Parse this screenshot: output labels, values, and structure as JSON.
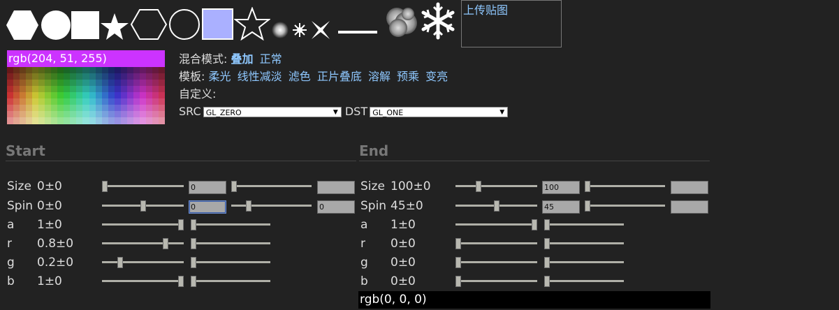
{
  "shapes": [
    {
      "name": "hexagon-filled-icon"
    },
    {
      "name": "circle-filled-icon"
    },
    {
      "name": "square-filled-icon"
    },
    {
      "name": "star-filled-icon"
    },
    {
      "name": "hexagon-outline-icon"
    },
    {
      "name": "circle-outline-icon"
    },
    {
      "name": "square-blue-icon"
    },
    {
      "name": "star-outline-icon"
    },
    {
      "name": "glow-dot-icon"
    },
    {
      "name": "sparkle-icon"
    },
    {
      "name": "cross-sparkle-icon"
    },
    {
      "name": "line-icon"
    },
    {
      "name": "smoke-icon"
    },
    {
      "name": "snowflake-icon"
    }
  ],
  "upload": {
    "label": "上传贴图"
  },
  "picker": {
    "value": "rgb(204, 51, 255)",
    "color": "#cc33ff"
  },
  "blend": {
    "mode_label": "混合模式:",
    "modes": [
      "叠加",
      "正常"
    ],
    "template_label": "模板:",
    "templates": [
      "柔光",
      "线性减淡",
      "滤色",
      "正片叠底",
      "溶解",
      "预乘",
      "变亮"
    ],
    "custom_label": "自定义:",
    "src_label": "SRC",
    "src_value": "GL_ZERO",
    "dst_label": "DST",
    "dst_value": "GL_ONE"
  },
  "start": {
    "title": "Start",
    "size": {
      "label": "Size",
      "value": "0±0",
      "input1": "0",
      "input2": ""
    },
    "spin": {
      "label": "Spin",
      "value": "0±0",
      "input1": "0",
      "input2": "0"
    },
    "a": {
      "label": "a",
      "value": "1±0"
    },
    "r": {
      "label": "r",
      "value": "0.8±0"
    },
    "g": {
      "label": "g",
      "value": "0.2±0"
    },
    "b": {
      "label": "b",
      "value": "1±0"
    }
  },
  "end": {
    "title": "End",
    "size": {
      "label": "Size",
      "value": "100±0",
      "input1": "100",
      "input2": ""
    },
    "spin": {
      "label": "Spin",
      "value": "45±0",
      "input1": "45",
      "input2": ""
    },
    "a": {
      "label": "a",
      "value": "1±0"
    },
    "r": {
      "label": "r",
      "value": "0±0"
    },
    "g": {
      "label": "g",
      "value": "0±0"
    },
    "b": {
      "label": "b",
      "value": "0±0"
    },
    "rgb": "rgb(0, 0, 0)"
  },
  "sliders": {
    "start_size_main": 0.0,
    "start_size_var": 0.0,
    "start_spin_main": 0.5,
    "start_spin_var": 0.2,
    "start_a_main": 1.0,
    "start_a_var": 0.0,
    "start_r_main": 0.8,
    "start_r_var": 0.0,
    "start_g_main": 0.2,
    "start_g_var": 0.0,
    "start_b_main": 1.0,
    "start_b_var": 0.0,
    "end_size_main": 0.27,
    "end_size_var": 0.0,
    "end_spin_main": 0.5,
    "end_spin_var": 0.0,
    "end_a_main": 1.0,
    "end_a_var": 0.0,
    "end_r_main": 0.0,
    "end_r_var": 0.0,
    "end_g_main": 0.0,
    "end_g_var": 0.0,
    "end_b_main": 0.0,
    "end_b_var": 0.0
  }
}
